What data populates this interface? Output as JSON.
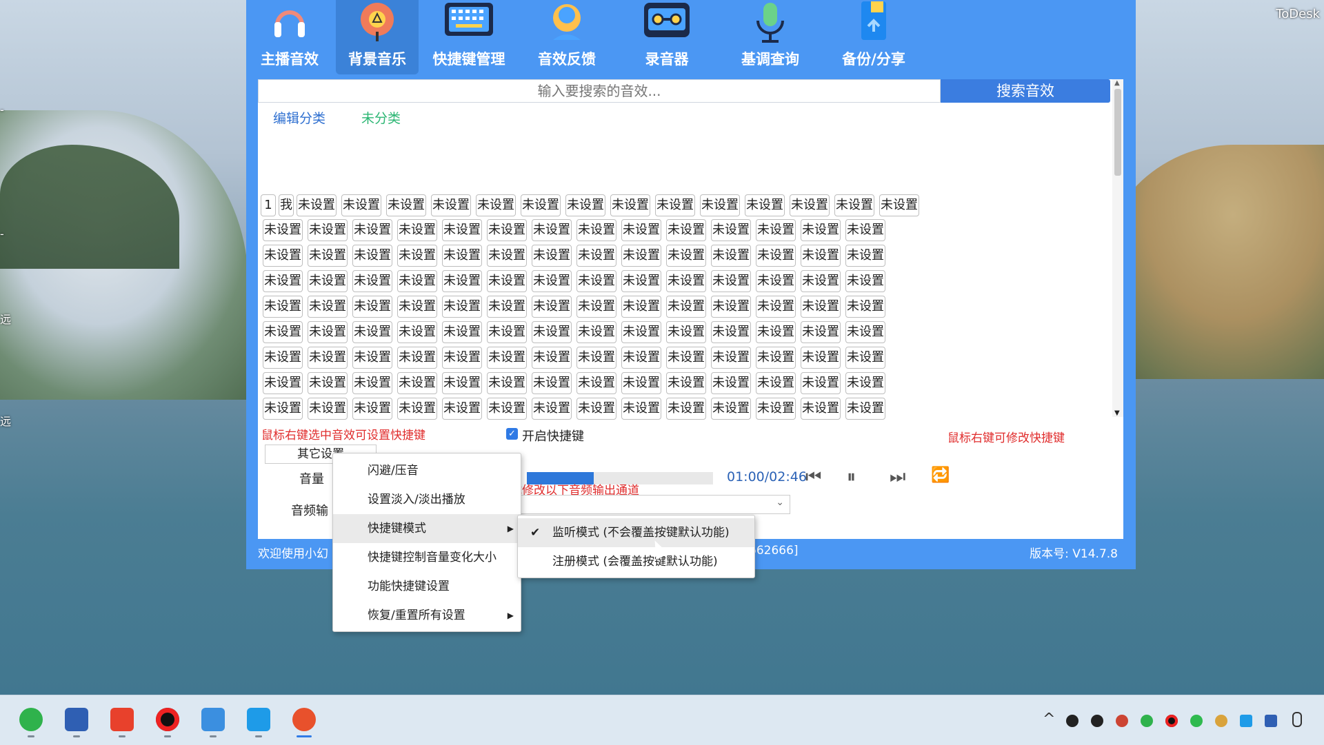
{
  "desktop": {
    "todesk_label": "ToDesk",
    "edge_chars": [
      "-",
      "-",
      "远",
      "远"
    ]
  },
  "nav": [
    {
      "label": "主播音效",
      "icon": "headphones-icon"
    },
    {
      "label": "背景音乐",
      "icon": "music-disc-icon",
      "active": true
    },
    {
      "label": "快捷键管理",
      "icon": "keyboard-icon"
    },
    {
      "label": "音效反馈",
      "icon": "feedback-icon"
    },
    {
      "label": "录音器",
      "icon": "cassette-icon"
    },
    {
      "label": "基调查询",
      "icon": "microphone-icon"
    },
    {
      "label": "备份/分享",
      "icon": "backup-icon"
    }
  ],
  "search": {
    "placeholder": "输入要搜索的音效...",
    "button": "搜索音效"
  },
  "tabs": [
    "编辑分类",
    "未分类"
  ],
  "grid": {
    "first_row": [
      "1",
      "我",
      "未设置",
      "未设置",
      "未设置",
      "未设置",
      "未设置",
      "未设置",
      "未设置",
      "未设置",
      "未设置",
      "未设置",
      "未设置",
      "未设置",
      "未设置",
      "未设置"
    ],
    "cell_label": "未设置",
    "rows": 9,
    "cols": 15
  },
  "hints": {
    "left": "鼠标右键选中音效可设置快捷键",
    "right": "鼠标右键可修改快捷键",
    "enable_hotkey": "开启快捷键",
    "warn": "，请尝试修改以下音频输出通道"
  },
  "player": {
    "other_settings": "其它设置",
    "volume_label": "音量",
    "output_label": "音频输",
    "progress": 0.36,
    "time": "01:00/02:46",
    "prev": "⏮",
    "pause": "⏸",
    "next": "⏭",
    "loop": "🔁"
  },
  "status": {
    "left": "欢迎使用小幻",
    "mid": "662666]",
    "version": "版本号: V14.7.8"
  },
  "context_menu": {
    "items": [
      "闪避/压音",
      "设置淡入/淡出播放",
      "快捷键模式",
      "快捷键控制音量变化大小",
      "功能快捷键设置",
      "恢复/重置所有设置"
    ],
    "submenu": [
      "监听模式 (不会覆盖按键默认功能)",
      "注册模式 (会覆盖按键默认功能)"
    ]
  },
  "colors": {
    "app_blue": "#4b97f3",
    "accent": "#3b7de0",
    "red": "#e02c2c"
  }
}
